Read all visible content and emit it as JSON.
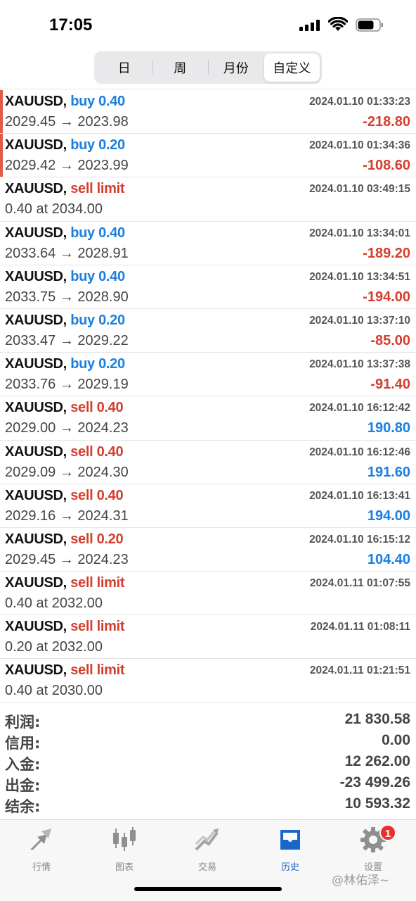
{
  "status_bar": {
    "time": "17:05"
  },
  "period_tabs": [
    {
      "label": "日",
      "active": false
    },
    {
      "label": "周",
      "active": false
    },
    {
      "label": "月份",
      "active": false
    },
    {
      "label": "自定义",
      "active": true
    }
  ],
  "orders": [
    {
      "symbol": "XAUUSD,",
      "type": "buy 0.40",
      "side": "buy",
      "time": "2024.01.10 01:33:23",
      "price": "2029.45 → 2023.98",
      "profit": "-218.80",
      "marked": true
    },
    {
      "symbol": "XAUUSD,",
      "type": "buy 0.20",
      "side": "buy",
      "time": "2024.01.10 01:34:36",
      "price": "2029.42 → 2023.99",
      "profit": "-108.60",
      "marked": true
    },
    {
      "symbol": "XAUUSD,",
      "type": "sell limit",
      "side": "sell",
      "time": "2024.01.10 03:49:15",
      "price": "0.40 at 2034.00",
      "profit": "",
      "marked": false
    },
    {
      "symbol": "XAUUSD,",
      "type": "buy 0.40",
      "side": "buy",
      "time": "2024.01.10 13:34:01",
      "price": "2033.64 → 2028.91",
      "profit": "-189.20",
      "marked": false
    },
    {
      "symbol": "XAUUSD,",
      "type": "buy 0.40",
      "side": "buy",
      "time": "2024.01.10 13:34:51",
      "price": "2033.75 → 2028.90",
      "profit": "-194.00",
      "marked": false
    },
    {
      "symbol": "XAUUSD,",
      "type": "buy 0.20",
      "side": "buy",
      "time": "2024.01.10 13:37:10",
      "price": "2033.47 → 2029.22",
      "profit": "-85.00",
      "marked": false
    },
    {
      "symbol": "XAUUSD,",
      "type": "buy 0.20",
      "side": "buy",
      "time": "2024.01.10 13:37:38",
      "price": "2033.76 → 2029.19",
      "profit": "-91.40",
      "marked": false
    },
    {
      "symbol": "XAUUSD,",
      "type": "sell 0.40",
      "side": "sell",
      "time": "2024.01.10 16:12:42",
      "price": "2029.00 → 2024.23",
      "profit": "190.80",
      "marked": false
    },
    {
      "symbol": "XAUUSD,",
      "type": "sell 0.40",
      "side": "sell",
      "time": "2024.01.10 16:12:46",
      "price": "2029.09 → 2024.30",
      "profit": "191.60",
      "marked": false
    },
    {
      "symbol": "XAUUSD,",
      "type": "sell 0.40",
      "side": "sell",
      "time": "2024.01.10 16:13:41",
      "price": "2029.16 → 2024.31",
      "profit": "194.00",
      "marked": false
    },
    {
      "symbol": "XAUUSD,",
      "type": "sell 0.20",
      "side": "sell",
      "time": "2024.01.10 16:15:12",
      "price": "2029.45 → 2024.23",
      "profit": "104.40",
      "marked": false
    },
    {
      "symbol": "XAUUSD,",
      "type": "sell limit",
      "side": "sell",
      "time": "2024.01.11 01:07:55",
      "price": "0.40 at 2032.00",
      "profit": "",
      "marked": false
    },
    {
      "symbol": "XAUUSD,",
      "type": "sell limit",
      "side": "sell",
      "time": "2024.01.11 01:08:11",
      "price": "0.20 at 2032.00",
      "profit": "",
      "marked": false
    },
    {
      "symbol": "XAUUSD,",
      "type": "sell limit",
      "side": "sell",
      "time": "2024.01.11 01:21:51",
      "price": "0.40 at 2030.00",
      "profit": "",
      "marked": false
    }
  ],
  "summary": [
    {
      "label": "利润:",
      "value": "21 830.58"
    },
    {
      "label": "信用:",
      "value": "0.00"
    },
    {
      "label": "入金:",
      "value": "12 262.00"
    },
    {
      "label": "出金:",
      "value": "-23 499.26"
    },
    {
      "label": "结余:",
      "value": "10 593.32"
    }
  ],
  "tabbar": [
    {
      "label": "行情",
      "icon": "quotes-icon",
      "active": false
    },
    {
      "label": "图表",
      "icon": "chart-icon",
      "active": false
    },
    {
      "label": "交易",
      "icon": "trade-icon",
      "active": false
    },
    {
      "label": "历史",
      "icon": "history-icon",
      "active": true
    },
    {
      "label": "设置",
      "icon": "settings-icon",
      "active": false,
      "badge": "1"
    }
  ],
  "watermark": "@林佑泽~",
  "colors": {
    "buy": "#1a7fe0",
    "sell": "#d33f2e",
    "active_tab": "#1a66c9",
    "badge": "#e8302c"
  }
}
